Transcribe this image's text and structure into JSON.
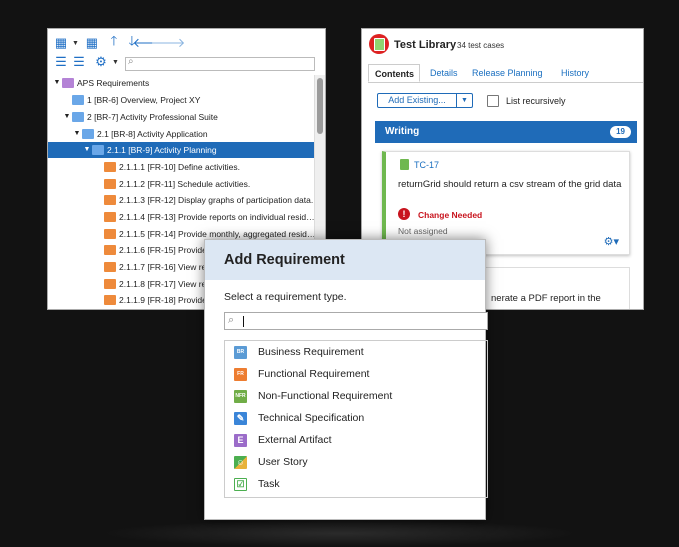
{
  "tree_panel": {
    "toolbar_icons": [
      "add-node-icon",
      "add-child-icon",
      "arrow-up-icon",
      "arrow-down-icon",
      "arrow-left-icon",
      "arrow-right-icon",
      "indent-icon",
      "outdent-icon",
      "settings-icon"
    ],
    "filter_placeholder": "",
    "nodes": [
      {
        "label": "APS Requirements",
        "type": "folder",
        "expanded": true
      },
      {
        "label": "1 [BR-6] Overview, Project XY",
        "type": "business"
      },
      {
        "label": "2 [BR-7] Activity Professional Suite",
        "type": "business",
        "expanded": true
      },
      {
        "label": "2.1 [BR-8] Activity Application",
        "type": "business",
        "expanded": true
      },
      {
        "label": "2.1.1 [BR-9] Activity Planning",
        "type": "business",
        "expanded": true,
        "selected": true
      },
      {
        "label": "2.1.1.1 [FR-10] Define activities.",
        "type": "functional"
      },
      {
        "label": "2.1.1.2 [FR-11] Schedule activities.",
        "type": "functional"
      },
      {
        "label": "2.1.1.3 [FR-12] Display graphs of participation data.",
        "type": "functional"
      },
      {
        "label": "2.1.1.4 [FR-13] Provide reports on individual resid…",
        "type": "functional"
      },
      {
        "label": "2.1.1.5 [FR-14] Provide monthly, aggregated resid…",
        "type": "functional"
      },
      {
        "label": "2.1.1.6 [FR-15] Provide",
        "type": "functional"
      },
      {
        "label": "2.1.1.7 [FR-16] View re",
        "type": "functional"
      },
      {
        "label": "2.1.1.8 [FR-17] View re",
        "type": "functional"
      },
      {
        "label": "2.1.1.9 [FR-18] Provide",
        "type": "functional"
      }
    ]
  },
  "test_library": {
    "title": "Test Library",
    "count": "34 test cases",
    "tabs": [
      "Contents",
      "Details",
      "Release Planning",
      "History"
    ],
    "active_tab": "Contents",
    "add_existing_label": "Add Existing...",
    "list_recursively_label": "List recursively",
    "list_recursively_checked": false,
    "section": {
      "title": "Writing",
      "count": "19"
    },
    "card": {
      "id": "TC-17",
      "title": "returnGrid should return a csv stream of the grid data",
      "status": "Change Needed",
      "assignee": "Not assigned"
    },
    "card2_text": "nerate a PDF report in the"
  },
  "dialog": {
    "title": "Add Requirement",
    "prompt": "Select a requirement type.",
    "search_value": "",
    "types": [
      {
        "label": "Business Requirement",
        "icon": "business-requirement-icon",
        "color": "#5b9bd5",
        "abbr": "BR"
      },
      {
        "label": "Functional Requirement",
        "icon": "functional-requirement-icon",
        "color": "#ed7d31",
        "abbr": "FR"
      },
      {
        "label": "Non-Functional Requirement",
        "icon": "non-functional-requirement-icon",
        "color": "#70ad47",
        "abbr": "NFR"
      },
      {
        "label": "Technical Specification",
        "icon": "technical-specification-icon",
        "color": "#3a85d8",
        "abbr": ""
      },
      {
        "label": "External Artifact",
        "icon": "external-artifact-icon",
        "color": "#9b6cc9",
        "abbr": "E"
      },
      {
        "label": "User Story",
        "icon": "user-story-icon",
        "color": "#4caf50",
        "abbr": ""
      },
      {
        "label": "Task",
        "icon": "task-icon",
        "color": "#4caf50",
        "abbr": ""
      }
    ]
  },
  "colors": {
    "selection": "#1f6bb8",
    "accent": "#1f6bb8",
    "status_error": "#c8141e",
    "writing_header": "#1f6bb8"
  }
}
